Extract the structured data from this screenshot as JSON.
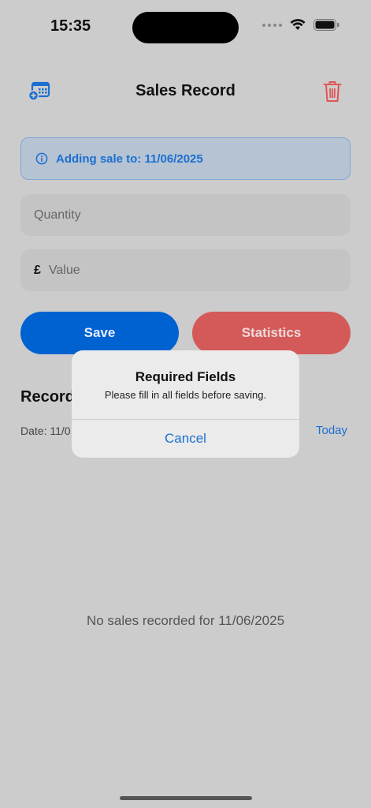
{
  "status_bar": {
    "time": "15:35"
  },
  "header": {
    "title": "Sales Record",
    "left_icon": "calendar-add-icon",
    "right_icon": "trash-icon"
  },
  "banner": {
    "text": "Adding sale to: 11/06/2025",
    "icon": "info-icon"
  },
  "form": {
    "quantity_placeholder": "Quantity",
    "currency_symbol": "£",
    "value_placeholder": "Value"
  },
  "buttons": {
    "save": "Save",
    "statistics": "Statistics"
  },
  "records": {
    "title": "Record",
    "date_label": "Date: 11/0",
    "today_link": "Today",
    "empty_message": "No sales recorded for 11/06/2025"
  },
  "alert": {
    "title": "Required Fields",
    "message": "Please fill in all fields before saving.",
    "cancel": "Cancel"
  },
  "colors": {
    "accent": "#0062d1",
    "danger": "#d45a5a",
    "background": "#cccccc"
  }
}
